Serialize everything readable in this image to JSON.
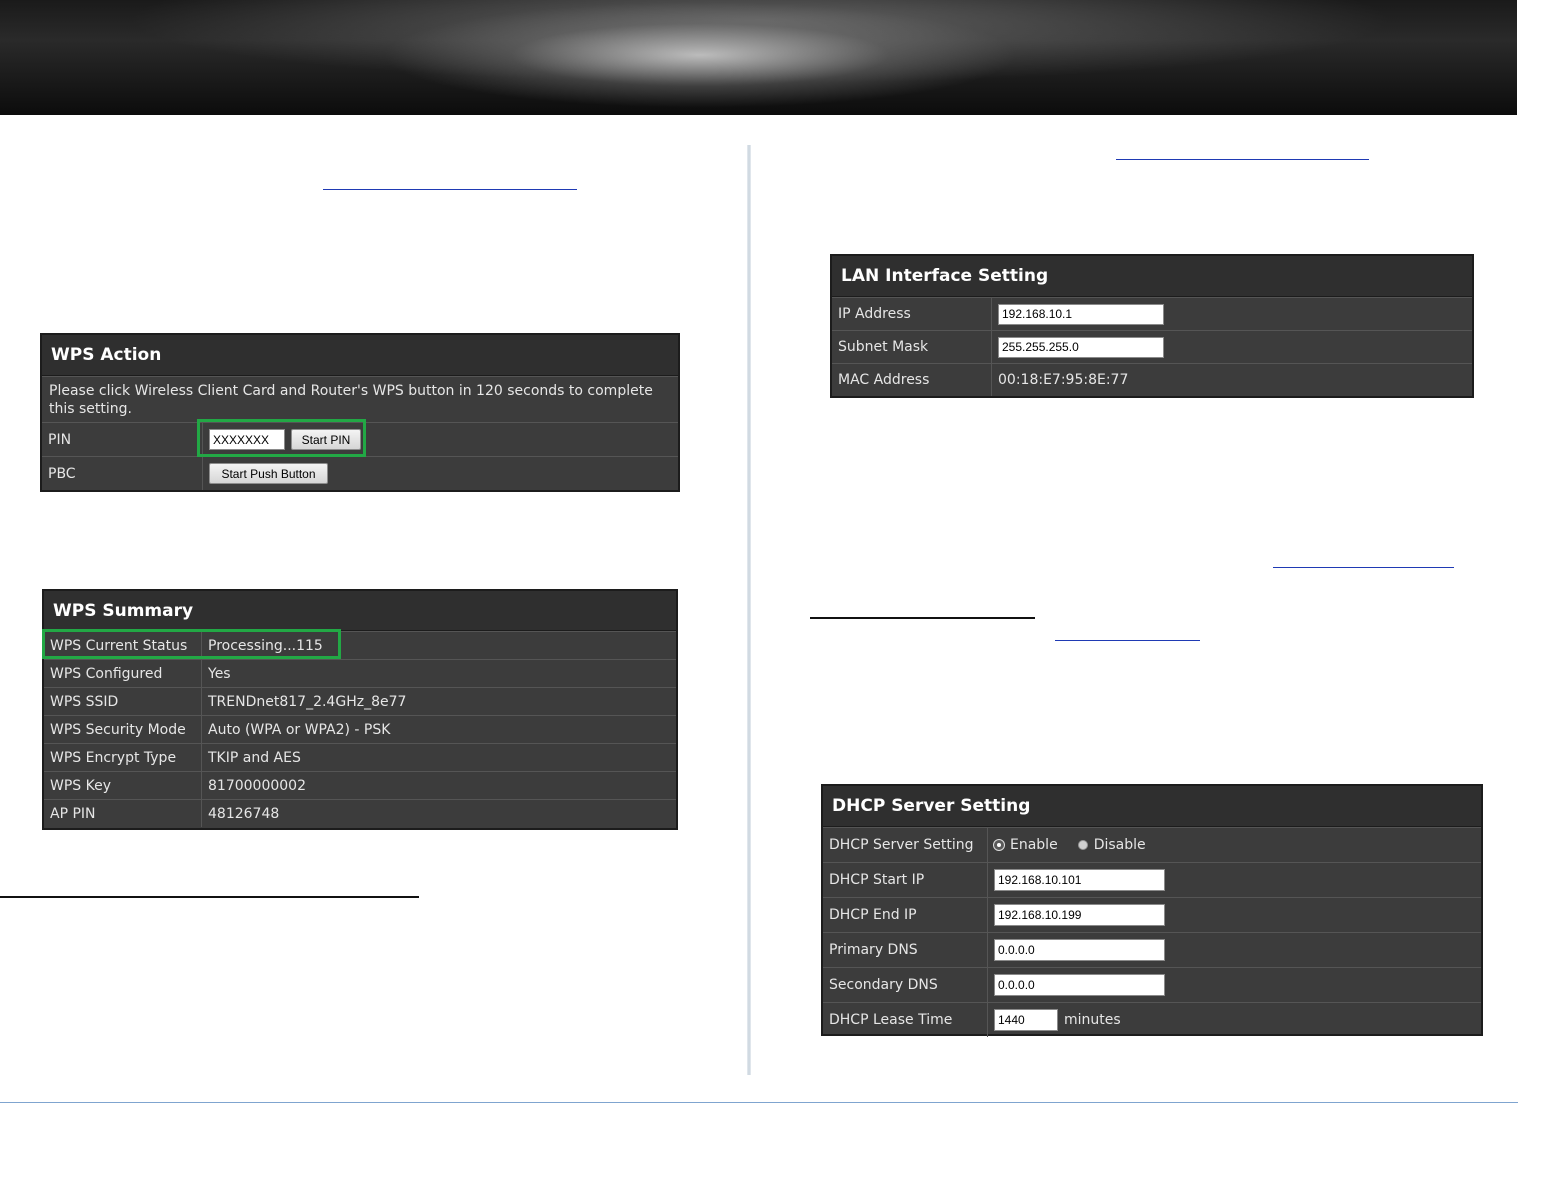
{
  "wps_action": {
    "title": "WPS Action",
    "message": "Please click Wireless Client Card and Router's WPS button in 120 seconds to complete this setting.",
    "pin_label": "PIN",
    "pin_value": "XXXXXXX",
    "start_pin_button": "Start PIN",
    "pbc_label": "PBC",
    "start_push_button": "Start Push Button"
  },
  "wps_summary": {
    "title": "WPS Summary",
    "rows": [
      {
        "label": "WPS Current Status",
        "value": "Processing...115"
      },
      {
        "label": "WPS Configured",
        "value": "Yes"
      },
      {
        "label": "WPS SSID",
        "value": "TRENDnet817_2.4GHz_8e77"
      },
      {
        "label": "WPS Security Mode",
        "value": "Auto (WPA or WPA2) - PSK"
      },
      {
        "label": "WPS Encrypt Type",
        "value": "TKIP and AES"
      },
      {
        "label": "WPS Key",
        "value": "81700000002"
      },
      {
        "label": "AP PIN",
        "value": "48126748"
      }
    ]
  },
  "lan": {
    "title": "LAN Interface Setting",
    "ip_label": "IP Address",
    "ip_value": "192.168.10.1",
    "mask_label": "Subnet Mask",
    "mask_value": "255.255.255.0",
    "mac_label": "MAC Address",
    "mac_value": "00:18:E7:95:8E:77"
  },
  "dhcp": {
    "title": "DHCP Server Setting",
    "server_label": "DHCP Server Setting",
    "enable_label": "Enable",
    "disable_label": "Disable",
    "selected": "Enable",
    "start_label": "DHCP Start IP",
    "start_value": "192.168.10.101",
    "end_label": "DHCP End IP",
    "end_value": "192.168.10.199",
    "dns1_label": "Primary DNS",
    "dns1_value": "0.0.0.0",
    "dns2_label": "Secondary DNS",
    "dns2_value": "0.0.0.0",
    "lease_label": "DHCP Lease Time",
    "lease_value": "1440",
    "lease_unit": "minutes"
  }
}
